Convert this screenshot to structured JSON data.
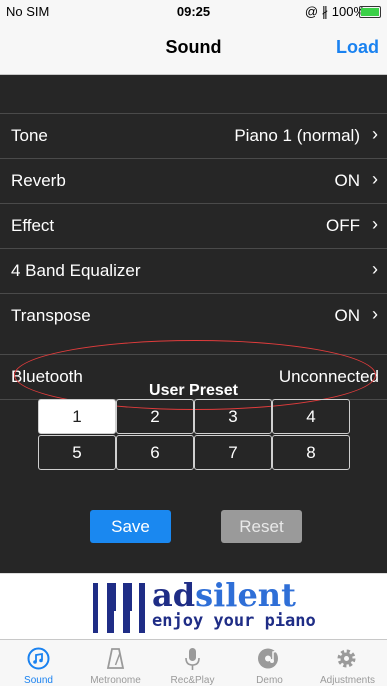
{
  "status_bar": {
    "carrier": "No SIM",
    "time": "09:25",
    "indicators": "@ ∦ 100%"
  },
  "nav": {
    "title": "Sound",
    "load_label": "Load"
  },
  "settings": [
    {
      "label": "Tone",
      "value": "Piano 1 (normal)"
    },
    {
      "label": "Reverb",
      "value": "ON"
    },
    {
      "label": "Effect",
      "value": "OFF"
    },
    {
      "label": "4 Band Equalizer",
      "value": ""
    },
    {
      "label": "Transpose",
      "value": "ON"
    }
  ],
  "bluetooth": {
    "label": "Bluetooth",
    "value": "Unconnected"
  },
  "user_preset": {
    "title": "User Preset",
    "slots": [
      "1",
      "2",
      "3",
      "4",
      "5",
      "6",
      "7",
      "8"
    ],
    "selected": "1",
    "save_label": "Save",
    "reset_label": "Reset"
  },
  "banner": {
    "brand_ad": "ad",
    "brand_silent": "silent",
    "tagline": "enjoy your piano"
  },
  "tabs": [
    {
      "label": "Sound",
      "icon": "sound-icon",
      "active": true
    },
    {
      "label": "Metronome",
      "icon": "metronome-icon",
      "active": false
    },
    {
      "label": "Rec&Play",
      "icon": "microphone-icon",
      "active": false
    },
    {
      "label": "Demo",
      "icon": "demo-icon",
      "active": false
    },
    {
      "label": "Adjustments",
      "icon": "gear-icon",
      "active": false
    }
  ],
  "colors": {
    "accent": "#1a82f0",
    "annotation": "#e03c3c",
    "background": "#262626"
  }
}
